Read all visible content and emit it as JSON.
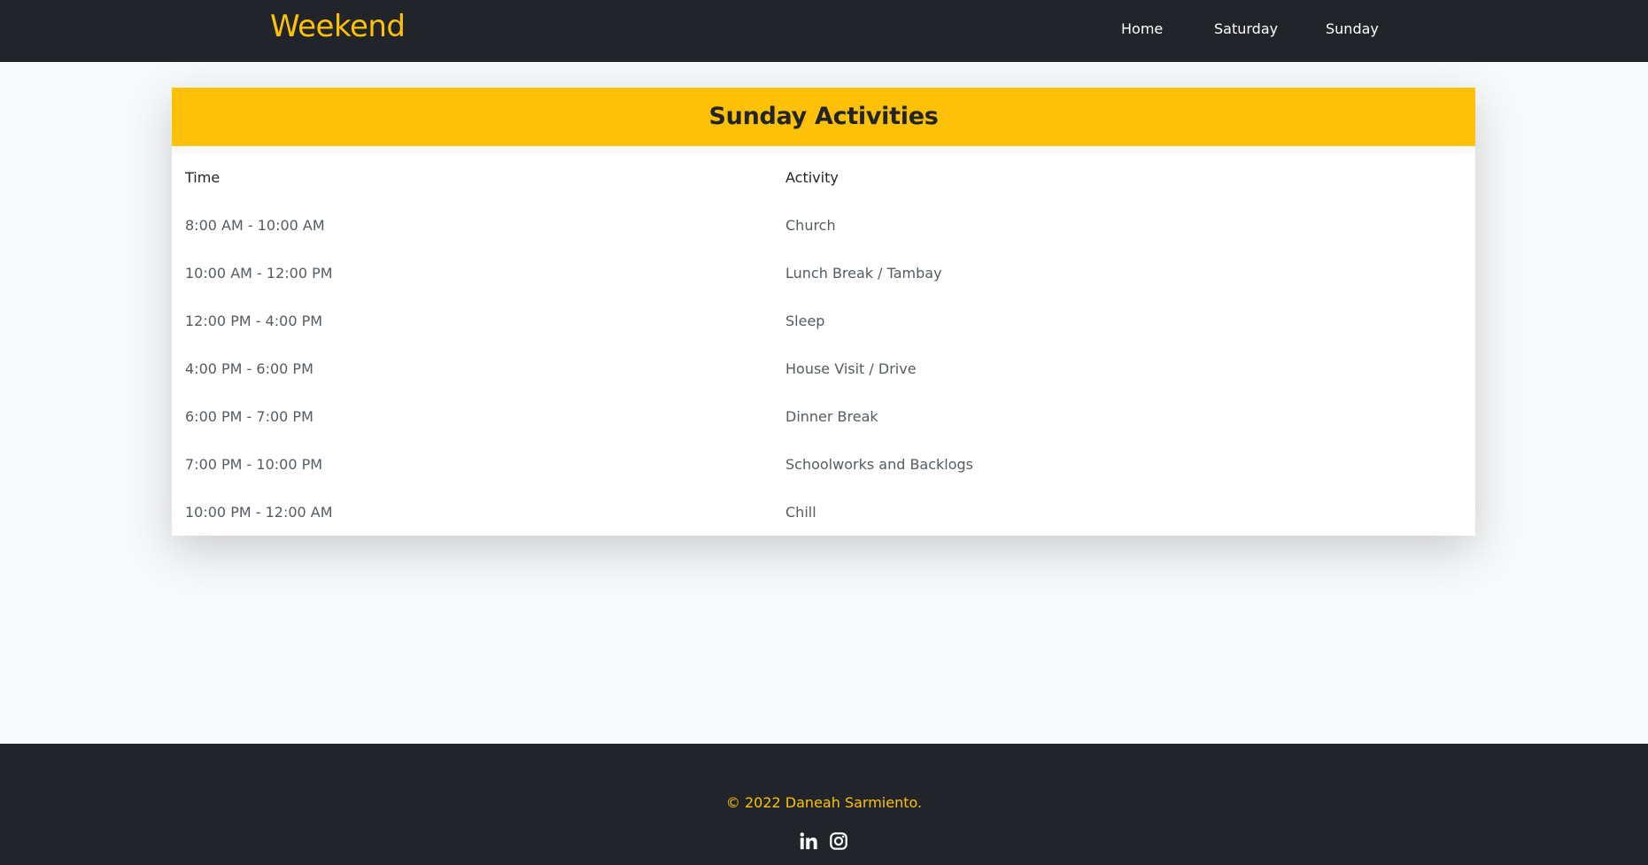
{
  "nav": {
    "brand": "Weekend",
    "links": [
      "Home",
      "Saturday",
      "Sunday"
    ]
  },
  "card": {
    "title": "Sunday Activities",
    "columns": [
      "Time",
      "Activity"
    ],
    "rows": [
      {
        "time": "8:00 AM - 10:00 AM",
        "activity": "Church"
      },
      {
        "time": "10:00 AM - 12:00 PM",
        "activity": "Lunch Break / Tambay"
      },
      {
        "time": "12:00 PM - 4:00 PM",
        "activity": "Sleep"
      },
      {
        "time": "4:00 PM - 6:00 PM",
        "activity": "House Visit / Drive"
      },
      {
        "time": "6:00 PM - 7:00 PM",
        "activity": "Dinner Break"
      },
      {
        "time": "7:00 PM - 10:00 PM",
        "activity": "Schoolworks and Backlogs"
      },
      {
        "time": "10:00 PM - 12:00 AM",
        "activity": "Chill"
      }
    ]
  },
  "footer": {
    "copyright": "© 2022 Daneah Sarmiento.",
    "social_icons": [
      "linkedin-icon",
      "instagram-icon"
    ]
  },
  "colors": {
    "accent": "#ffc107",
    "dark": "#212529",
    "page_background": "#f8f9fa"
  }
}
